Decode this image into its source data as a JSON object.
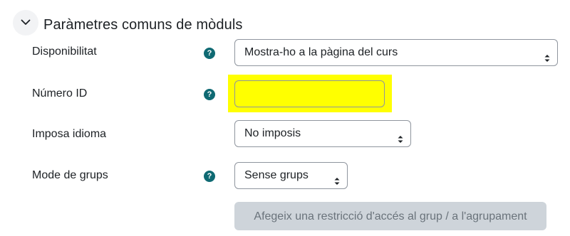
{
  "section": {
    "title": "Paràmetres comuns de mòduls",
    "collapse_icon": "chevron-down-icon"
  },
  "fields": {
    "availability": {
      "label": "Disponibilitat",
      "value": "Mostra-ho a la pàgina del curs",
      "help_icon": "question-icon"
    },
    "id_number": {
      "label": "Número ID",
      "value": "",
      "highlight_color": "#ffff00",
      "help_icon": "question-icon"
    },
    "force_language": {
      "label": "Imposa idioma",
      "value": "No imposis"
    },
    "group_mode": {
      "label": "Mode de grups",
      "value": "Sense grups",
      "help_icon": "question-icon"
    }
  },
  "restriction_button": {
    "label": "Afegeix una restricció d'accés al grup / a l'agrupament",
    "state": "disabled"
  },
  "colors": {
    "help_icon": "#0f6a73",
    "text": "#1d2125",
    "border": "#8f959e",
    "disabled_button": "#ced4da"
  }
}
